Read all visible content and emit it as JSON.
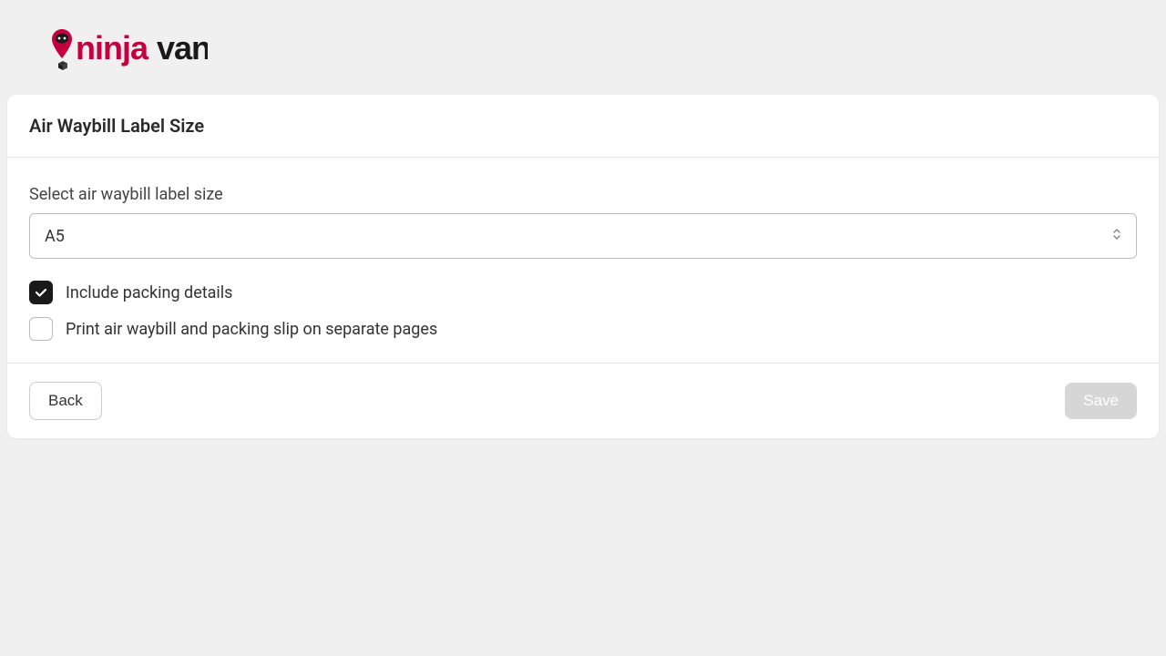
{
  "logo": {
    "ninja": "ninja",
    "van": "van"
  },
  "card": {
    "title": "Air Waybill Label Size",
    "selectLabel": "Select air waybill label size",
    "selectedValue": "A5",
    "checkboxes": {
      "includePacking": {
        "label": "Include packing details",
        "checked": true
      },
      "separatePages": {
        "label": "Print air waybill and packing slip on separate pages",
        "checked": false
      }
    },
    "backLabel": "Back",
    "saveLabel": "Save"
  }
}
